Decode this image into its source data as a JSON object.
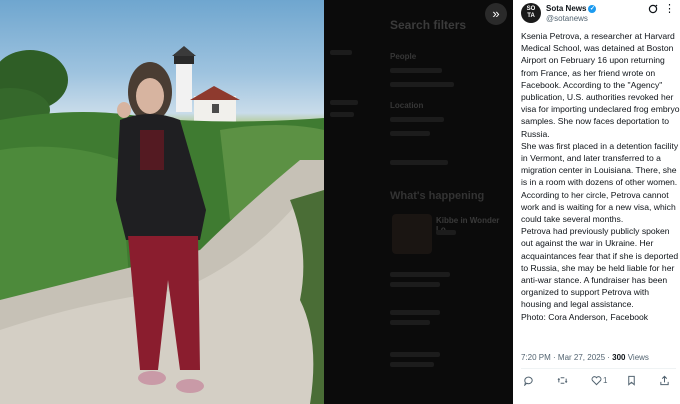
{
  "viewer": {
    "expand_icon": "double-chevron-right-icon",
    "expand_glyph": "»"
  },
  "background_app": {
    "title": "Search filters",
    "people_header": "People",
    "location_header": "Location",
    "whats_happening": "What's happening",
    "trend_item": "Kibbe in Wonder Lo..."
  },
  "tweet": {
    "avatar_text": "SO\nTA",
    "author_name": "Sota News",
    "author_handle": "@sotanews",
    "paragraphs": [
      "Ksenia Petrova, a researcher at Harvard Medical School, was detained at Boston Airport on February 16 upon returning from France, as her friend wrote on Facebook. According to the \"Agency\" publication, U.S. authorities revoked her visa for importing undeclared frog embryo samples. She now faces deportation to Russia.",
      "She was first placed in a detention facility in Vermont, and later transferred to a migration center in Louisiana. There, she is in a room with dozens of other women. According to her circle, Petrova cannot work and is waiting for a new visa, which could take several months.",
      "Petrova had previously publicly spoken out against the war in Ukraine. Her acquaintances fear that if she is deported to Russia, she may be held liable for her anti-war stance. A fundraiser has been organized to support Petrova with housing and legal assistance.",
      "Photo: Cora Anderson, Facebook"
    ],
    "timestamp": "7:20 PM · Mar 27, 2025 · ",
    "views_count": "300",
    "views_label": " Views",
    "like_count": "1",
    "colors": {
      "verified": "#1d9bf0",
      "secondary_text": "#536471"
    }
  }
}
